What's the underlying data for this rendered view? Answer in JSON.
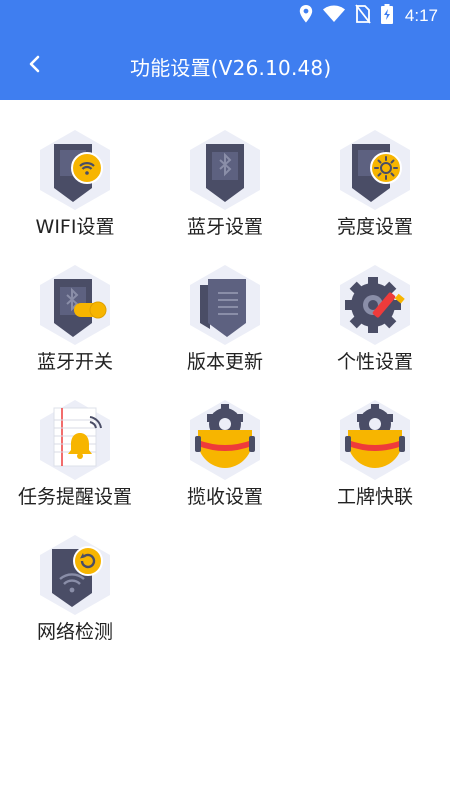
{
  "status_bar": {
    "time": "4:17",
    "icons": [
      "location-icon",
      "wifi-signal-icon",
      "no-sim-icon",
      "battery-charging-icon"
    ]
  },
  "header": {
    "title": "功能设置(V26.10.48)",
    "back_icon": "back-arrow-icon",
    "background_color": "#3f7ef0"
  },
  "items": [
    {
      "id": "wifi",
      "label": "WIFI设置",
      "icon": "wifi-settings-icon"
    },
    {
      "id": "bluetooth",
      "label": "蓝牙设置",
      "icon": "bluetooth-settings-icon"
    },
    {
      "id": "brightness",
      "label": "亮度设置",
      "icon": "brightness-settings-icon"
    },
    {
      "id": "bluetooth-switch",
      "label": "蓝牙开关",
      "icon": "bluetooth-toggle-icon"
    },
    {
      "id": "version-update",
      "label": "版本更新",
      "icon": "version-update-icon"
    },
    {
      "id": "personalization",
      "label": "个性设置",
      "icon": "personalization-gear-icon"
    },
    {
      "id": "task-reminder",
      "label": "任务提醒设置",
      "icon": "task-reminder-bell-icon"
    },
    {
      "id": "pickup",
      "label": "揽收设置",
      "icon": "pickup-robot-icon"
    },
    {
      "id": "badge-link",
      "label": "工牌快联",
      "icon": "badge-robot-icon"
    },
    {
      "id": "network-check",
      "label": "网络检测",
      "icon": "network-check-icon"
    }
  ]
}
